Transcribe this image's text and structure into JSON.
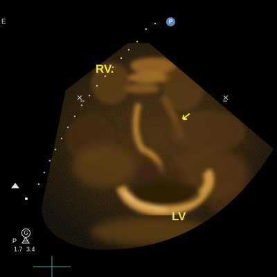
{
  "labels": {
    "rv": "RV.",
    "lv": "LV"
  },
  "overlay": {
    "edge_letter": "E",
    "probe_marker": "P",
    "gain_marker": "G",
    "probe_side": "P",
    "depth_values": [
      "1.7",
      "3.4"
    ]
  },
  "icons": [
    "arrow-icon",
    "triangle-marker-icon",
    "crosshair-icon"
  ],
  "colors": {
    "annotation": "#f2ea27",
    "probe_badge": "#5a86c8",
    "tissue": "#c8892e"
  }
}
